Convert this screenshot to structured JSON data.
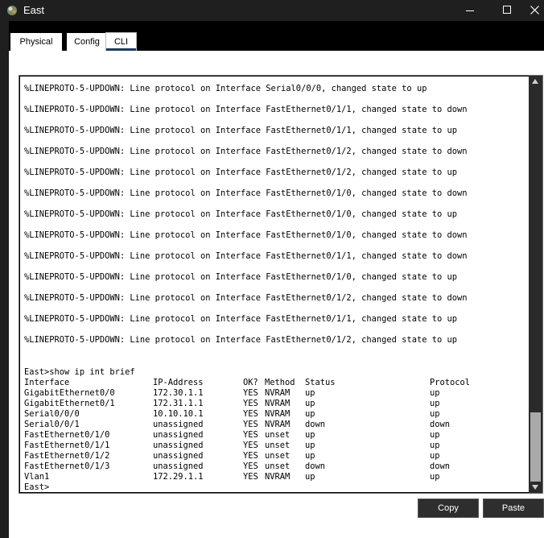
{
  "window": {
    "title": "East",
    "icon": "router-app-icon",
    "controls": [
      "minimize-icon",
      "maximize-icon",
      "close-icon"
    ]
  },
  "tabs": [
    {
      "label": "Physical",
      "active": false
    },
    {
      "label": "Config",
      "active": false
    },
    {
      "label": "CLI",
      "active": true
    }
  ],
  "terminal": {
    "log_lines": [
      "%LINEPROTO-5-UPDOWN: Line protocol on Interface Serial0/0/0, changed state to up",
      "%LINEPROTO-5-UPDOWN: Line protocol on Interface FastEthernet0/1/1, changed state to down",
      "%LINEPROTO-5-UPDOWN: Line protocol on Interface FastEthernet0/1/1, changed state to up",
      "%LINEPROTO-5-UPDOWN: Line protocol on Interface FastEthernet0/1/2, changed state to down",
      "%LINEPROTO-5-UPDOWN: Line protocol on Interface FastEthernet0/1/2, changed state to up",
      "%LINEPROTO-5-UPDOWN: Line protocol on Interface FastEthernet0/1/0, changed state to down",
      "%LINEPROTO-5-UPDOWN: Line protocol on Interface FastEthernet0/1/0, changed state to up",
      "%LINEPROTO-5-UPDOWN: Line protocol on Interface FastEthernet0/1/0, changed state to down",
      "%LINEPROTO-5-UPDOWN: Line protocol on Interface FastEthernet0/1/1, changed state to down",
      "%LINEPROTO-5-UPDOWN: Line protocol on Interface FastEthernet0/1/0, changed state to up",
      "%LINEPROTO-5-UPDOWN: Line protocol on Interface FastEthernet0/1/2, changed state to down",
      "%LINEPROTO-5-UPDOWN: Line protocol on Interface FastEthernet0/1/1, changed state to up",
      "%LINEPROTO-5-UPDOWN: Line protocol on Interface FastEthernet0/1/2, changed state to up"
    ],
    "command": "East>show ip int brief",
    "table_headers": [
      "Interface",
      "IP-Address",
      "OK?",
      "Method",
      "Status",
      "Protocol"
    ],
    "table_rows": [
      [
        "GigabitEthernet0/0",
        "172.30.1.1",
        "YES",
        "NVRAM",
        "up",
        "up"
      ],
      [
        "GigabitEthernet0/1",
        "172.31.1.1",
        "YES",
        "NVRAM",
        "up",
        "up"
      ],
      [
        "Serial0/0/0",
        "10.10.10.1",
        "YES",
        "NVRAM",
        "up",
        "up"
      ],
      [
        "Serial0/0/1",
        "unassigned",
        "YES",
        "NVRAM",
        "down",
        "down"
      ],
      [
        "FastEthernet0/1/0",
        "unassigned",
        "YES",
        "unset",
        "up",
        "up"
      ],
      [
        "FastEthernet0/1/1",
        "unassigned",
        "YES",
        "unset",
        "up",
        "up"
      ],
      [
        "FastEthernet0/1/2",
        "unassigned",
        "YES",
        "unset",
        "up",
        "up"
      ],
      [
        "FastEthernet0/1/3",
        "unassigned",
        "YES",
        "unset",
        "down",
        "down"
      ],
      [
        "Vlan1",
        "172.29.1.1",
        "YES",
        "NVRAM",
        "up",
        "up"
      ]
    ],
    "prompt": "East>",
    "scroll_position": 1.0
  },
  "buttons": {
    "copy_label": "Copy",
    "paste_label": "Paste"
  }
}
